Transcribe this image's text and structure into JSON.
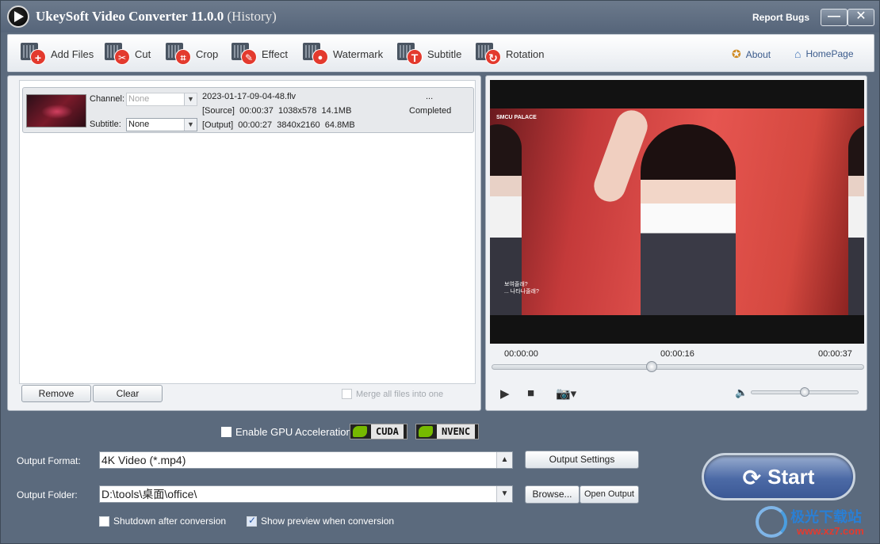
{
  "window": {
    "title": "UkeySoft Video Converter 11.0.0",
    "title_suffix": "(History)",
    "report_bugs": "Report Bugs",
    "minimize_glyph": "—",
    "close_glyph": "✕"
  },
  "toolbar": {
    "items": [
      {
        "label": "Add Files",
        "icon": "add-icon",
        "glyph": "+"
      },
      {
        "label": "Cut",
        "icon": "scissors-icon",
        "glyph": "✂"
      },
      {
        "label": "Crop",
        "icon": "crop-icon",
        "glyph": "⌗"
      },
      {
        "label": "Effect",
        "icon": "magic-wand-icon",
        "glyph": "✎"
      },
      {
        "label": "Watermark",
        "icon": "drop-icon",
        "glyph": "●"
      },
      {
        "label": "Subtitle",
        "icon": "text-icon",
        "glyph": "T"
      },
      {
        "label": "Rotation",
        "icon": "rotate-icon",
        "glyph": "↻"
      }
    ],
    "about": "About",
    "homepage": "HomePage"
  },
  "file_list": {
    "item": {
      "channel_label": "Channel:",
      "channel_value": "None",
      "subtitle_label": "Subtitle:",
      "subtitle_value": "None",
      "filename": "2023-01-17-09-04-48.flv",
      "source_tag": "[Source]",
      "source_duration": "00:00:37",
      "source_resolution": "1038x578",
      "source_size": "14.1MB",
      "output_tag": "[Output]",
      "output_duration": "00:00:27",
      "output_resolution": "3840x2160",
      "output_size": "64.8MB",
      "more": "...",
      "status": "Completed"
    },
    "remove": "Remove",
    "clear": "Clear",
    "merge": "Merge all files into one"
  },
  "preview": {
    "video_tag_1": "SMCU PALACE",
    "video_sub_1": "보여줄래?",
    "video_sub_2": "... 나타나줄래?",
    "time_start": "00:00:00",
    "time_current": "00:00:16",
    "time_end": "00:00:37",
    "progress": 0.43,
    "volume": 0.5
  },
  "gpu": {
    "label": "Enable GPU Acceleration",
    "cuda": "CUDA",
    "nvenc": "NVENC"
  },
  "output": {
    "format_label": "Output Format:",
    "format_value": "4K Video (*.mp4)",
    "settings": "Output Settings",
    "folder_label": "Output Folder:",
    "folder_value": "D:\\tools\\桌面\\office\\",
    "browse": "Browse...",
    "open_output": "Open Output",
    "shutdown": "Shutdown after conversion",
    "show_preview": "Show preview when conversion"
  },
  "start": "Start",
  "watermark": {
    "text": "极光下载站",
    "url": "www.xz7.com"
  }
}
